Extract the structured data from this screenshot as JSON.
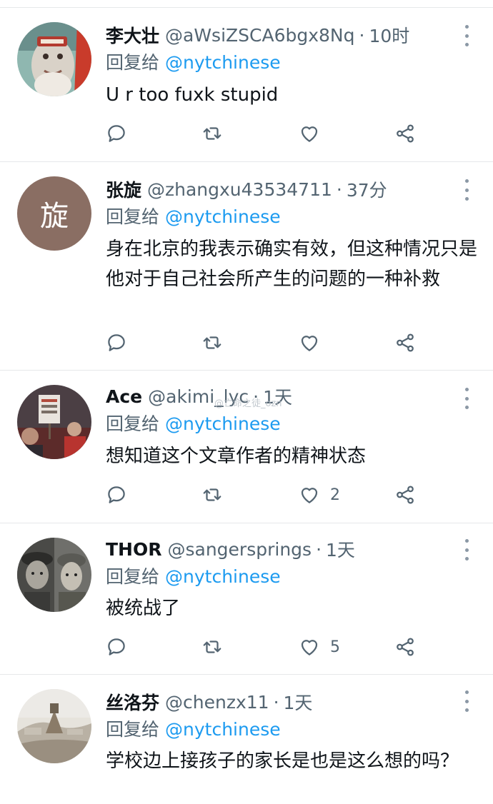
{
  "tweets": [
    {
      "name": "李大壮",
      "handle": "@aWsiZSCA6bgx8Nq",
      "time": "10时",
      "reply_prefix": "回复给",
      "reply_to": "@nytchinese",
      "text": "U r too fuxk stupid",
      "likes": "",
      "avatar": "cartoon-figure-avatar"
    },
    {
      "name": "张旋",
      "handle": "@zhangxu43534711",
      "time": "37分",
      "reply_prefix": "回复给",
      "reply_to": "@nytchinese",
      "text": "身在北京的我表示确实有效，但这种情况只是他对于自己社会所产生的问题的一种补救",
      "likes": "",
      "avatar_letter": "旋"
    },
    {
      "name": "Ace",
      "handle": "@akimi_lyc",
      "time": "1天",
      "reply_prefix": "回复给",
      "reply_to": "@nytchinese",
      "text": "想知道这个文章作者的精神状态",
      "likes": "2",
      "avatar": "protest-photo-avatar"
    },
    {
      "name": "THOR",
      "handle": "@sangersprings",
      "time": "1天",
      "reply_prefix": "回复给",
      "reply_to": "@nytchinese",
      "text": "被统战了",
      "likes": "5",
      "avatar": "two-soldiers-avatar"
    },
    {
      "name": "丝洛芬",
      "handle": "@chenzx11",
      "time": "1天",
      "reply_prefix": "回复给",
      "reply_to": "@nytchinese",
      "text": "学校边上接孩子的家长是也是这么想的吗？",
      "likes": "",
      "avatar": "landscape-photo-avatar"
    }
  ],
  "watermark": "@亡命之徒_ozn",
  "colors": {
    "accent": "#1d9bf0",
    "muted": "#536471",
    "text": "#0f1419",
    "divider": "#e6e8ea"
  },
  "icons": [
    "more-icon",
    "reply-icon",
    "retweet-icon",
    "like-icon",
    "share-icon"
  ]
}
